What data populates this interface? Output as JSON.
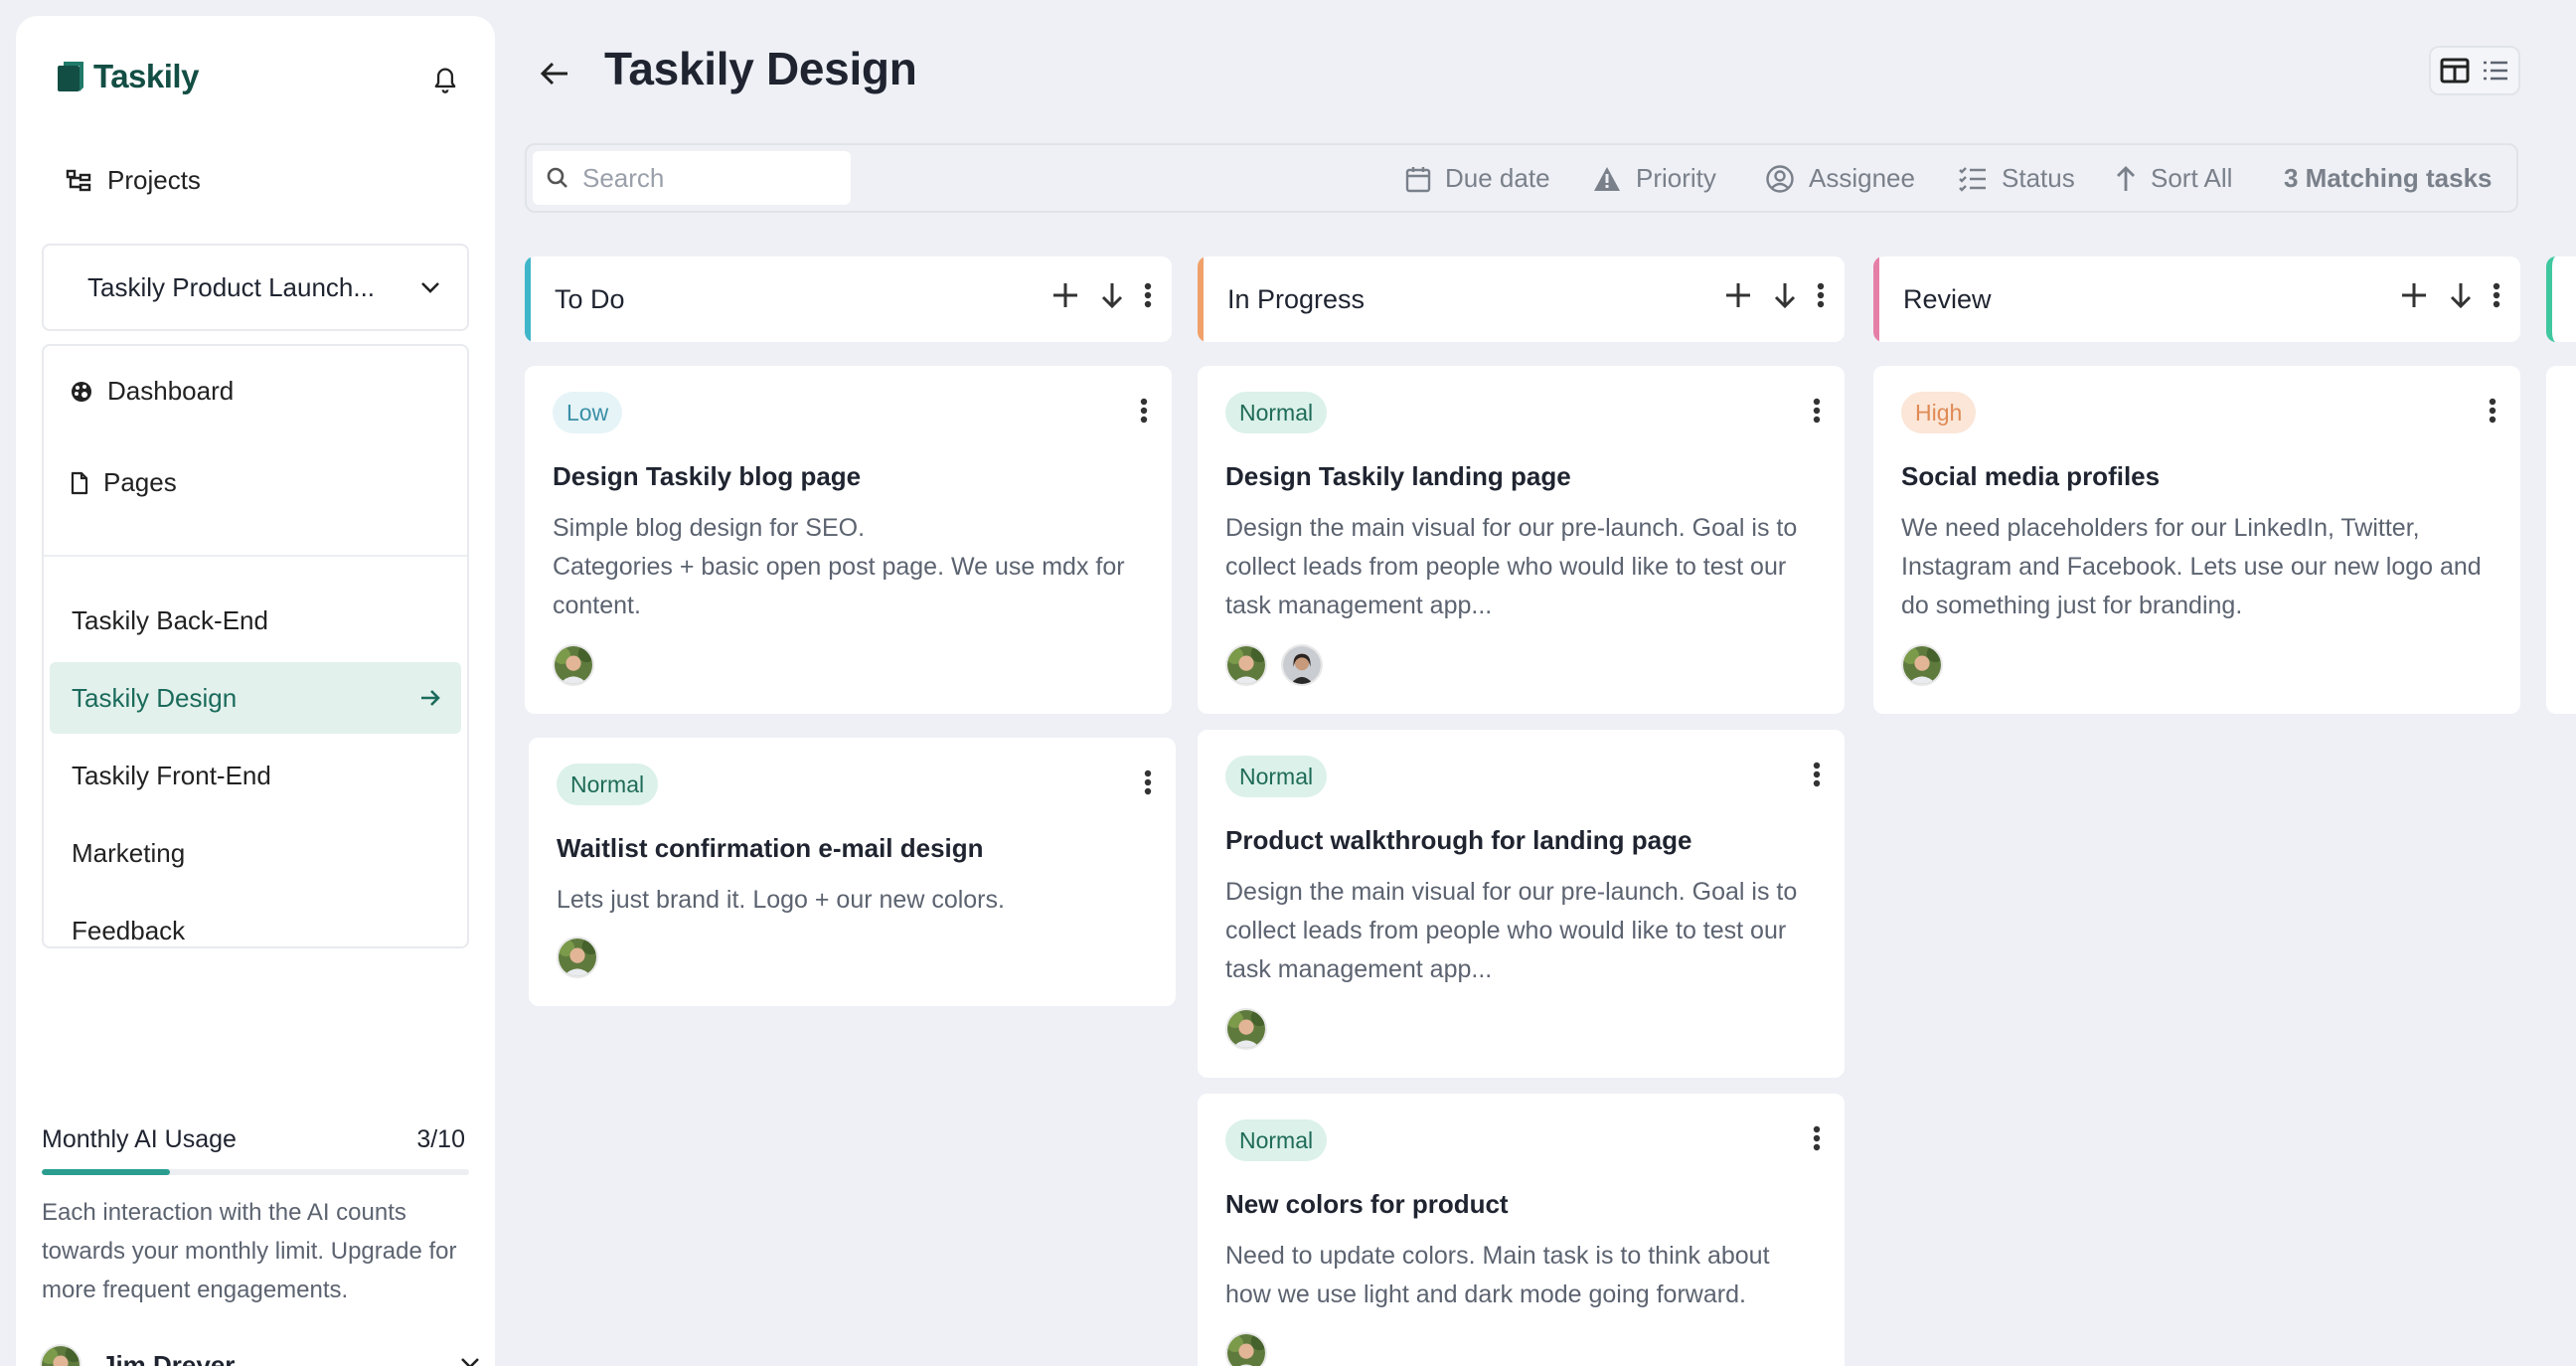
{
  "app": {
    "name": "Taskily"
  },
  "colors": {
    "brand": "#134e44",
    "accent": "#2a9d8f"
  },
  "sidebar": {
    "projects_label": "Projects",
    "workspace": "Taskily Product Launch...",
    "nav": [
      {
        "label": "Dashboard",
        "icon": "palette-icon"
      },
      {
        "label": "Pages",
        "icon": "page-icon"
      }
    ],
    "projects": [
      {
        "label": "Taskily Back-End"
      },
      {
        "label": "Taskily Design",
        "active": true
      },
      {
        "label": "Taskily Front-End"
      },
      {
        "label": "Marketing"
      },
      {
        "label": "Feedback"
      }
    ],
    "ai_usage": {
      "title": "Monthly AI Usage",
      "count": "3/10",
      "progress": 0.3,
      "description": "Each interaction with the AI counts towards your monthly limit. Upgrade for more frequent engagements."
    },
    "user": {
      "name": "Jim Dreyer"
    }
  },
  "header": {
    "title": "Taskily Design"
  },
  "filters": {
    "search_placeholder": "Search",
    "due_date": "Due date",
    "priority": "Priority",
    "assignee": "Assignee",
    "status": "Status",
    "sort": "Sort All",
    "matching": "3 Matching tasks"
  },
  "columns": [
    {
      "title": "To Do",
      "color": "#3fb5c9",
      "cards": [
        {
          "priority": "Low",
          "level": "low",
          "title": "Design Taskily blog page",
          "description": "Simple blog design for SEO.\nCategories + basic open post page. We use mdx for content.",
          "assignees": [
            "man"
          ]
        },
        {
          "priority": "Normal",
          "level": "normal",
          "title": "Waitlist  confirmation e-mail design",
          "description": "Lets just brand it. Logo + our new colors.",
          "assignees": [
            "man"
          ]
        }
      ]
    },
    {
      "title": "In Progress",
      "color": "#f0a06a",
      "cards": [
        {
          "priority": "Normal",
          "level": "normal",
          "title": "Design Taskily landing page",
          "description": "Design the main visual for our pre-launch. Goal is to collect leads from people who would like to test our task management app...",
          "assignees": [
            "man",
            "woman"
          ]
        },
        {
          "priority": "Normal",
          "level": "normal",
          "title": "Product walkthrough for landing page",
          "description": "Design the main visual for our pre-launch. Goal is to collect leads from people who would like to test our task management app...",
          "assignees": [
            "man"
          ]
        },
        {
          "priority": "Normal",
          "level": "normal",
          "title": "New colors for product",
          "description": "Need to update colors. Main task is to think about how we use light and dark mode going forward.",
          "assignees": [
            "man"
          ]
        }
      ]
    },
    {
      "title": "Review",
      "color": "#e57fa7",
      "cards": [
        {
          "priority": "High",
          "level": "high",
          "title": "Social media profiles",
          "description": "We need placeholders for our LinkedIn, Twitter, Instagram and Facebook. Lets use our new logo and do something just for branding.",
          "assignees": [
            "man"
          ]
        }
      ]
    }
  ]
}
